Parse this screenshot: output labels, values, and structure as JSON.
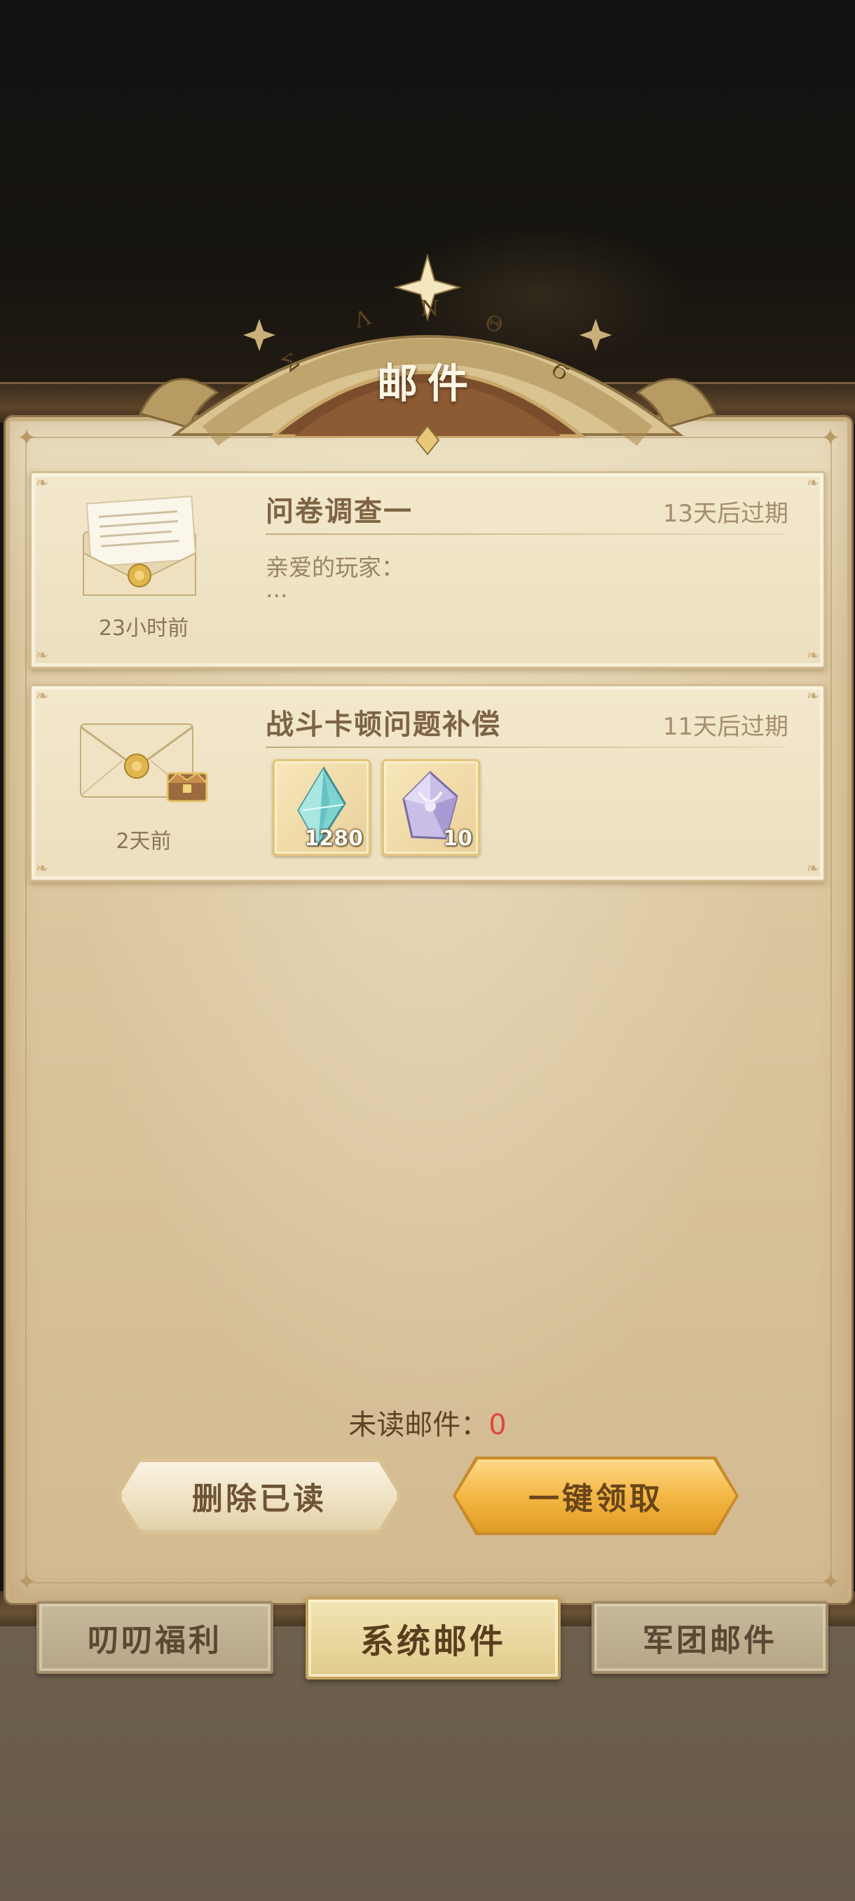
{
  "header": {
    "title": "邮件",
    "arch_letters": [
      "Σ",
      "Λ",
      "Ν",
      "Θ",
      "Ϭ"
    ]
  },
  "mails": [
    {
      "title": "问卷调查一",
      "expire": "13天后过期",
      "time": "23小时前",
      "body_lines": [
        "亲爱的玩家：",
        "..."
      ],
      "envelope_icon": "open-envelope-letter-icon",
      "rewards": []
    },
    {
      "title": "战斗卡顿问题补偿",
      "expire": "11天后过期",
      "time": "2天前",
      "body_lines": [],
      "envelope_icon": "sealed-envelope-with-chest-icon",
      "rewards": [
        {
          "icon": "blue-crystal-icon",
          "count": "1280"
        },
        {
          "icon": "purple-crystal-icon",
          "count": "10"
        }
      ]
    }
  ],
  "footer": {
    "unread_label": "未读邮件：",
    "unread_count": "0",
    "delete_read_label": "删除已读",
    "claim_all_label": "一键领取"
  },
  "tabs": [
    {
      "label": "叨叨福利",
      "active": false
    },
    {
      "label": "系统邮件",
      "active": true
    },
    {
      "label": "军团邮件",
      "active": false
    }
  ],
  "colors": {
    "parchment": "#decba4",
    "title_text": "#fff7e6",
    "unread_count": "#e0483c",
    "claim_button": "#f3b744"
  }
}
